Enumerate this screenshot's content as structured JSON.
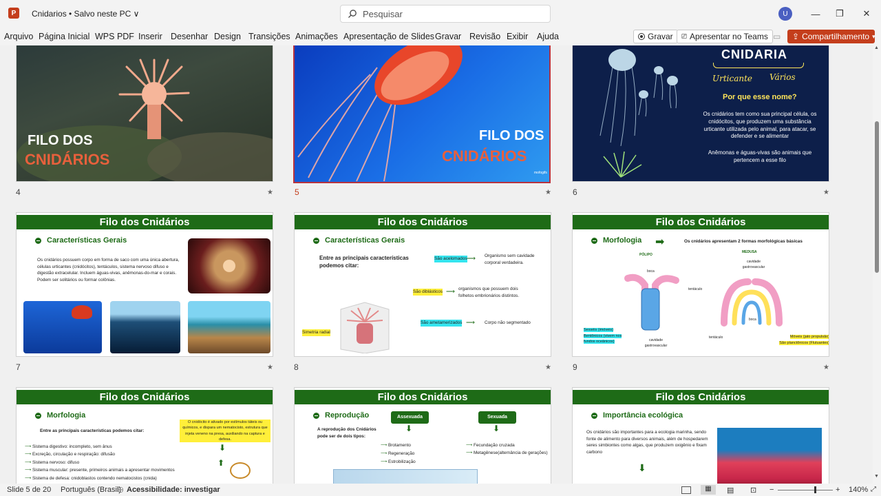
{
  "window": {
    "app_icon": "P",
    "doc_title": "Cnidarios • Salvo neste PC ∨",
    "search_placeholder": "Pesquisar",
    "user_initial": "U"
  },
  "menu": [
    "Arquivo",
    "Página Inicial",
    "WPS PDF",
    "Inserir",
    "Desenhar",
    "Design",
    "Transições",
    "Animações",
    "Apresentação de Slides",
    "Gravar",
    "Revisão",
    "Exibir",
    "Ajuda"
  ],
  "ribbon_buttons": {
    "record": "Gravar",
    "present_teams": "Apresentar no Teams",
    "share": "Compartilhamento"
  },
  "slides": {
    "s4": {
      "number": "4",
      "line1": "FILO DOS",
      "line2": "CNIDÁRIOS"
    },
    "s5": {
      "number": "5",
      "line1": "FILO DOS",
      "line2": "CNIDÁRIOS",
      "credit": "mofogifs"
    },
    "s6": {
      "number": "6",
      "title": "CNIDARIA",
      "word1": "Urticante",
      "word2": "Vários",
      "question": "Por que esse nome?",
      "text1": "Os cnidários tem como sua principal célula, os cnidócitos, que produzem uma substância urticante utilizada pelo animal, para atacar, se defender e se alimentar",
      "text2": "Anêmonas e águas-vivas são animais que pertencem a esse filo"
    },
    "s7": {
      "number": "7",
      "header": "Filo dos Cnidários",
      "section": "Características Gerais",
      "text": "Os cnidários possuem corpo em forma de saco com uma única abertura, células urticantes (cnidócitos), tentáculos, sistema nervoso difuso e digestão extracelular. Incluem águas-vivas, anêmonas-do-mar e corais. Podem ser solitários ou formar colônias."
    },
    "s8": {
      "number": "8",
      "header": "Filo dos Cnidários",
      "section": "Características Gerais",
      "intro": "Entre as principais características podemos citar:",
      "t1": "São acelomados",
      "d1": "Organismo sem cavidade corporal verdadeira.",
      "t2": "São diblásticos",
      "d2": "organismos que possuem dois folhetos embrionários distintos.",
      "t3": "São ametamerizados",
      "d3": "Corpo não segmentado",
      "t4": "Simetria radial"
    },
    "s9": {
      "number": "9",
      "header": "Filo dos Cnidários",
      "section": "Morfologia",
      "intro": "Os cnidários apresentam 2 formas morfológicas básicas",
      "polipo": "PÓLIPO",
      "medusa": "MEDUSA",
      "boca": "boca",
      "tentaculo": "tentáculo",
      "cavidade": "cavidade gastrovascular",
      "polipo_note1": "Sesséis (imóveis)",
      "polipo_note2": "Bentônicos (vivem nos fundos oceânicos)",
      "medusa_note1": "Móveis (jato propulsão)",
      "medusa_note2": "São planctônicos (Flutuantes)"
    },
    "s10": {
      "header": "Filo dos Cnidários",
      "section": "Morfologia",
      "intro": "Entre as principais características podemos citar:",
      "items": [
        "Sistema digestivo: incompleto, sem ânus",
        "Excreção, circulação e respiração: difusão",
        "Sistema nervoso: difuso",
        "Sistema muscular: presente, primeiros animais a apresentar movimentos",
        "Sistema de defesa: cnidoblastos contendo nematocistos (cnida)"
      ],
      "note": "O cnidócito é ativado por estímulos táteis ou químicos, e dispara um nematocisto, estrutura que injeta veneno na presa, auxiliando na captura e defesa."
    },
    "s11": {
      "header": "Filo dos Cnidários",
      "section": "Reprodução",
      "intro": "A reprodução dos Cnidários pode ser de dois tipos:",
      "asex": "Assexuada",
      "sex": "Sexuada",
      "asex_items": [
        "Brotamento",
        "Regeneração",
        "Estrobilização"
      ],
      "sex_items": [
        "Fecundação cruzada",
        "Metagênese(alternância de gerações)"
      ]
    },
    "s12": {
      "header": "Filo dos Cnidários",
      "section": "Importância ecológica",
      "text": "Os cnidários são importantes para a ecologia marinha, sendo fonte de alimento para diversos animais, além de hospedarem seres simbiontes como algas, que produzem oxigênio e fixam carbono"
    }
  },
  "status": {
    "slide": "Slide 5 de 20",
    "language": "Português (Brasil)",
    "accessibility": "Acessibilidade: investigar",
    "zoom": "140%"
  }
}
